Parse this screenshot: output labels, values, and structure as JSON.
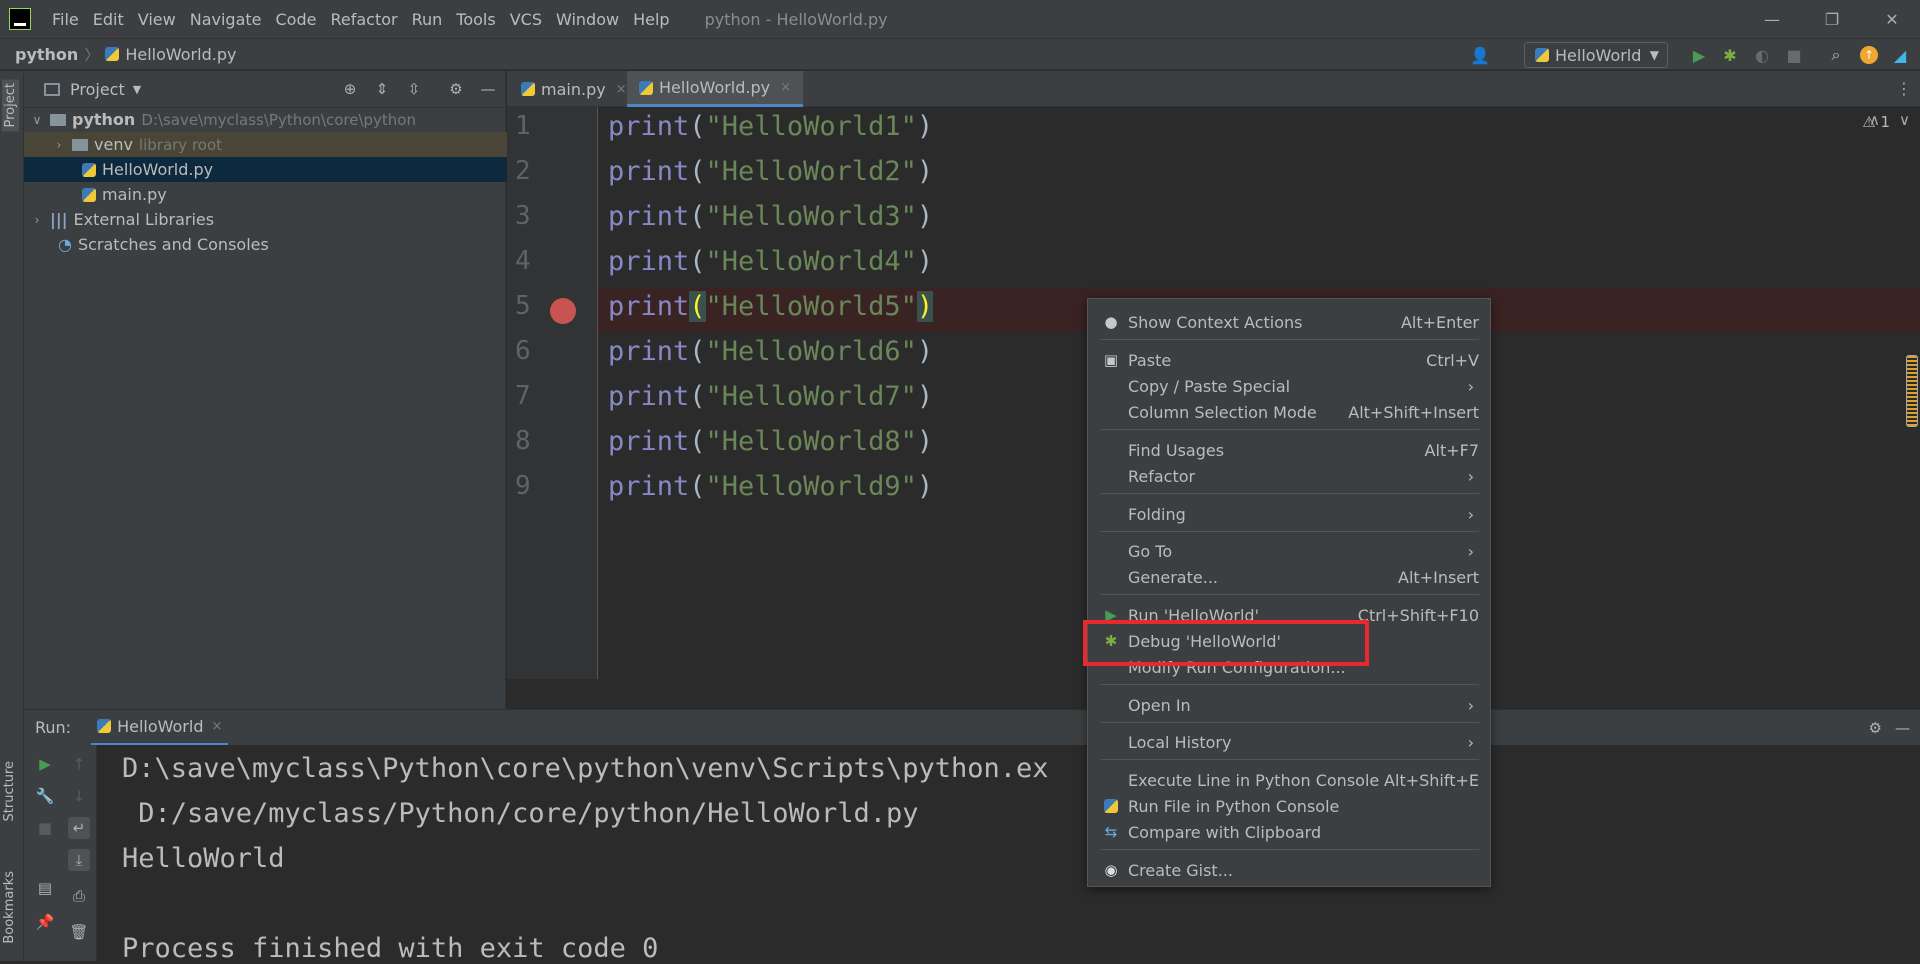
{
  "window": {
    "title": "python - HelloWorld.py",
    "menu": [
      "File",
      "Edit",
      "View",
      "Navigate",
      "Code",
      "Refactor",
      "Run",
      "Tools",
      "VCS",
      "Window",
      "Help"
    ],
    "controls": {
      "minimize": "—",
      "restore": "❐",
      "close": "✕"
    }
  },
  "navbar": {
    "breadcrumb_root": "python",
    "breadcrumb_sep": "〉",
    "breadcrumb_file": "HelloWorld.py",
    "run_config": "HelloWorld",
    "run_config_arrow": "▼"
  },
  "left_strip": {
    "project_tab": "Project",
    "structure_tab": "Structure",
    "bookmarks_tab": "Bookmarks"
  },
  "project": {
    "header": "Project",
    "header_arrow": "▼",
    "tree": [
      {
        "label": "python",
        "hint": "D:\\save\\myclass\\Python\\core\\python",
        "chev": "∨"
      },
      {
        "label": "venv",
        "hint": "library root",
        "chev": "›"
      },
      {
        "label": "HelloWorld.py"
      },
      {
        "label": "main.py"
      },
      {
        "label": "External Libraries",
        "chev": "›"
      },
      {
        "label": "Scratches and Consoles"
      }
    ]
  },
  "tabs": [
    {
      "label": "main.py",
      "close": "×"
    },
    {
      "label": "HelloWorld.py",
      "close": "×"
    }
  ],
  "editor": {
    "warning": "⚠ 1",
    "lines": [
      {
        "num": "1",
        "kw": "print",
        "open": "(",
        "str": "\"HelloWorld1\"",
        "close": ")"
      },
      {
        "num": "2",
        "kw": "print",
        "open": "(",
        "str": "\"HelloWorld2\"",
        "close": ")"
      },
      {
        "num": "3",
        "kw": "print",
        "open": "(",
        "str": "\"HelloWorld3\"",
        "close": ")"
      },
      {
        "num": "4",
        "kw": "print",
        "open": "(",
        "str": "\"HelloWorld4\"",
        "close": ")"
      },
      {
        "num": "5",
        "kw": "print",
        "open": "(",
        "str": "\"HelloWorld5\"",
        "close": ")"
      },
      {
        "num": "6",
        "kw": "print",
        "open": "(",
        "str": "\"HelloWorld6\"",
        "close": ")"
      },
      {
        "num": "7",
        "kw": "print",
        "open": "(",
        "str": "\"HelloWorld7\"",
        "close": ")"
      },
      {
        "num": "8",
        "kw": "print",
        "open": "(",
        "str": "\"HelloWorld8\"",
        "close": ")"
      },
      {
        "num": "9",
        "kw": "print",
        "open": "(",
        "str": "\"HelloWorld9\"",
        "close": ")"
      }
    ]
  },
  "run": {
    "label": "Run:",
    "tab": "HelloWorld",
    "tab_close": "×",
    "console": [
      "D:\\save\\myclass\\Python\\core\\python\\venv\\Scripts\\python.ex",
      " D:/save/myclass/Python/core/python/HelloWorld.py",
      "HelloWorld",
      "",
      "Process finished with exit code 0"
    ]
  },
  "context_menu": {
    "items": [
      {
        "label": "Show Context Actions",
        "shortcut": "Alt+Enter",
        "icon": "💡"
      },
      {
        "label": "Paste",
        "shortcut": "Ctrl+V",
        "icon": "📋"
      },
      {
        "label": "Copy / Paste Special",
        "submenu": "›"
      },
      {
        "label": "Column Selection Mode",
        "shortcut": "Alt+Shift+Insert"
      },
      {
        "label": "Find Usages",
        "shortcut": "Alt+F7"
      },
      {
        "label": "Refactor",
        "submenu": "›"
      },
      {
        "label": "Folding",
        "submenu": "›"
      },
      {
        "label": "Go To",
        "submenu": "›"
      },
      {
        "label": "Generate...",
        "shortcut": "Alt+Insert"
      },
      {
        "label": "Run 'HelloWorld'",
        "shortcut": "Ctrl+Shift+F10",
        "icon": "▶"
      },
      {
        "label": "Debug 'HelloWorld'",
        "icon": "🐞"
      },
      {
        "label": "Modify Run Configuration..."
      },
      {
        "label": "Open In",
        "submenu": "›"
      },
      {
        "label": "Local History",
        "submenu": "›"
      },
      {
        "label": "Execute Line in Python Console",
        "shortcut": "Alt+Shift+E"
      },
      {
        "label": "Run File in Python Console"
      },
      {
        "label": "Compare with Clipboard"
      },
      {
        "label": "Create Gist..."
      }
    ]
  },
  "colors": {
    "highlight_box": "#e8292e",
    "breakpoint": "#c75450",
    "run_green": "#499c54"
  }
}
